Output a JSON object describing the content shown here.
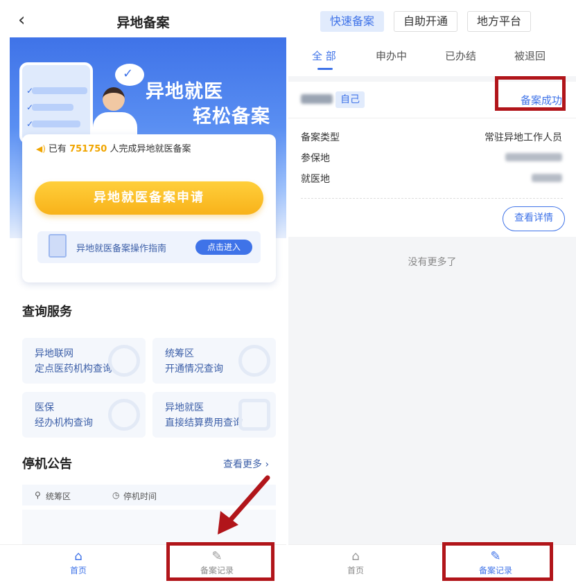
{
  "left": {
    "back_glyph": "‹",
    "title": "异地备案",
    "banner": {
      "line1": "异地就医",
      "line2": "轻松备案"
    },
    "counter": {
      "prefix": "已有",
      "number": "751750",
      "suffix": "人完成异地就医备案"
    },
    "apply_button": "异地就医备案申请",
    "guide": {
      "text": "异地就医备案操作指南",
      "button": "点击进入"
    },
    "query_section": {
      "title": "查询服务",
      "items": [
        {
          "line1": "异地联网",
          "line2": "定点医药机构查询"
        },
        {
          "line1": "统筹区",
          "line2": "开通情况查询"
        },
        {
          "line1": "医保",
          "line2": "经办机构查询"
        },
        {
          "line1": "异地就医",
          "line2": "直接结算费用查询"
        }
      ]
    },
    "notice_section": {
      "title": "停机公告",
      "more": "查看更多 ›",
      "col1": "统筹区",
      "col2": "停机时间"
    },
    "tabbar": {
      "home": "首页",
      "records": "备案记录"
    }
  },
  "right": {
    "segments": [
      "快速备案",
      "自助开通",
      "地方平台"
    ],
    "tabs": [
      "全 部",
      "申办中",
      "已办结",
      "被退回"
    ],
    "record": {
      "tag": "自己",
      "status": "备案成功",
      "fields": [
        {
          "key": "备案类型",
          "value": "常驻异地工作人员"
        },
        {
          "key": "参保地",
          "value": ""
        },
        {
          "key": "就医地",
          "value": ""
        }
      ],
      "detail_button": "查看详情"
    },
    "no_more": "没有更多了",
    "tabbar": {
      "home": "首页",
      "records": "备案记录"
    }
  },
  "colors": {
    "primary": "#3f73e8",
    "accent": "#f8b21a",
    "annotation": "#b1151a"
  }
}
